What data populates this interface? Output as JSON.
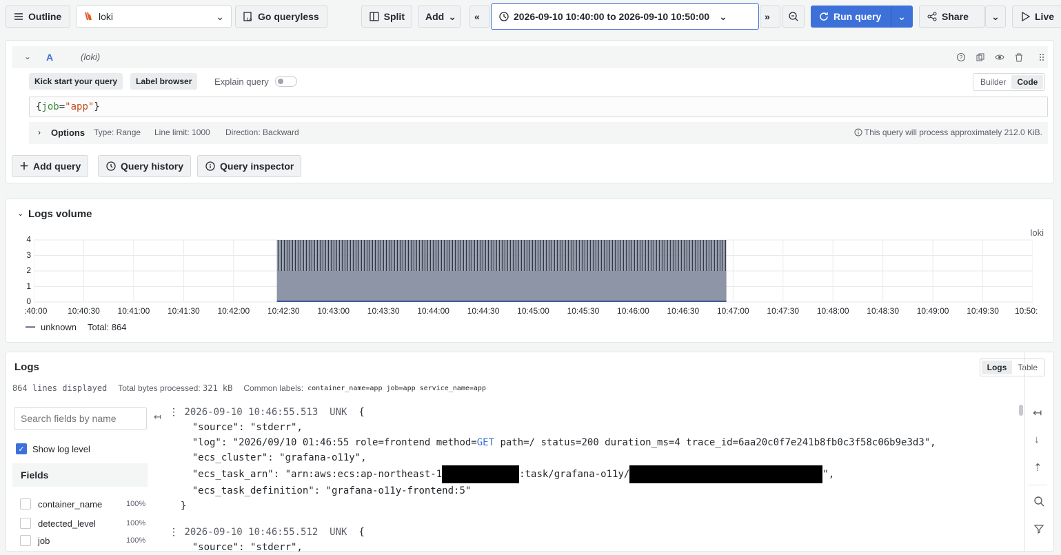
{
  "toolbar": {
    "outline_label": "Outline",
    "datasource": "loki",
    "go_queryless_label": "Go queryless",
    "split_label": "Split",
    "add_label": "Add",
    "time_range": "2026-09-10 10:40:00 to 2026-09-10 10:50:00",
    "run_query_label": "Run query",
    "share_label": "Share",
    "live_label": "Live"
  },
  "query": {
    "ref_id": "A",
    "datasource_hint": "(loki)",
    "kick_start_label": "Kick start your query",
    "label_browser_label": "Label browser",
    "explain_label": "Explain query",
    "builder_label": "Builder",
    "code_label": "Code",
    "expr_brace_open": "{",
    "expr_key": "job",
    "expr_eq": "=",
    "expr_value": "\"app\"",
    "expr_brace_close": "}",
    "options_label": "Options",
    "type_text": "Type: Range",
    "line_limit_text": "Line limit: 1000",
    "direction_text": "Direction: Backward",
    "process_text": "This query will process approximately 212.0 KiB.",
    "add_query_label": "Add query",
    "history_label": "Query history",
    "inspector_label": "Query inspector"
  },
  "volume": {
    "title": "Logs volume",
    "datasource_label": "loki",
    "legend_label": "unknown",
    "total_text": "Total: 864",
    "colors": {
      "bar": "#8d95a6",
      "edge": "#2b3240"
    }
  },
  "chart_data": {
    "type": "bar",
    "title": "Logs volume",
    "ylim": [
      0,
      4
    ],
    "y_ticks": [
      "0",
      "1",
      "2",
      "3",
      "4"
    ],
    "x_ticks": [
      ":40:00",
      "10:40:30",
      "10:41:00",
      "10:41:30",
      "10:42:00",
      "10:42:30",
      "10:43:00",
      "10:43:30",
      "10:44:00",
      "10:44:30",
      "10:45:00",
      "10:45:30",
      "10:46:00",
      "10:46:30",
      "10:47:00",
      "10:47:30",
      "10:48:00",
      "10:48:30",
      "10:49:00",
      "10:49:30",
      "10:50:"
    ],
    "series": [
      {
        "name": "unknown",
        "range_start": "10:42:26",
        "range_end": "10:46:56",
        "base_value": 2,
        "peak_value": 4
      }
    ],
    "grid": true,
    "legend_position": "bottom-left"
  },
  "logs": {
    "title": "Logs",
    "logs_tab": "Logs",
    "table_tab": "Table",
    "lines_displayed": "864 lines displayed",
    "bytes_label": "Total bytes processed:",
    "bytes_value": "321 kB",
    "common_labels_label": "Common labels:",
    "common_labels": [
      "container_name=app",
      "job=app",
      "service_name=app"
    ],
    "search_placeholder": "Search fields by name",
    "show_level_label": "Show log level",
    "fields_title": "Fields",
    "fields": [
      {
        "name": "container_name",
        "pct": "100%"
      },
      {
        "name": "detected_level",
        "pct": "100%"
      },
      {
        "name": "job",
        "pct": "100%"
      }
    ],
    "entry1": {
      "timestamp": "2026-09-10 10:46:55.513",
      "level": "UNK",
      "l_source": "\"source\": \"stderr\",",
      "l_log_pre": "\"log\": \"2026/09/10 01:46:55 role=frontend method=",
      "l_log_get": "GET",
      "l_log_post": " path=/ status=200 duration_ms=4 trace_id=6aa20c0f7e241b8fb0c3f58c06b9e3d3\",",
      "l_cluster": "\"ecs_cluster\": \"grafana-o11y\",",
      "l_arn_a": "\"ecs_task_arn\": \"arn:aws:ecs:ap-northeast-1",
      "l_arn_b": ":task/grafana-o11y/",
      "l_arn_c": "\",",
      "l_def": "\"ecs_task_definition\": \"grafana-o11y-frontend:5\"",
      "close": "}"
    },
    "entry2": {
      "timestamp": "2026-09-10 10:46:55.512",
      "level": "UNK",
      "l_source": "\"source\": \"stderr\","
    }
  }
}
